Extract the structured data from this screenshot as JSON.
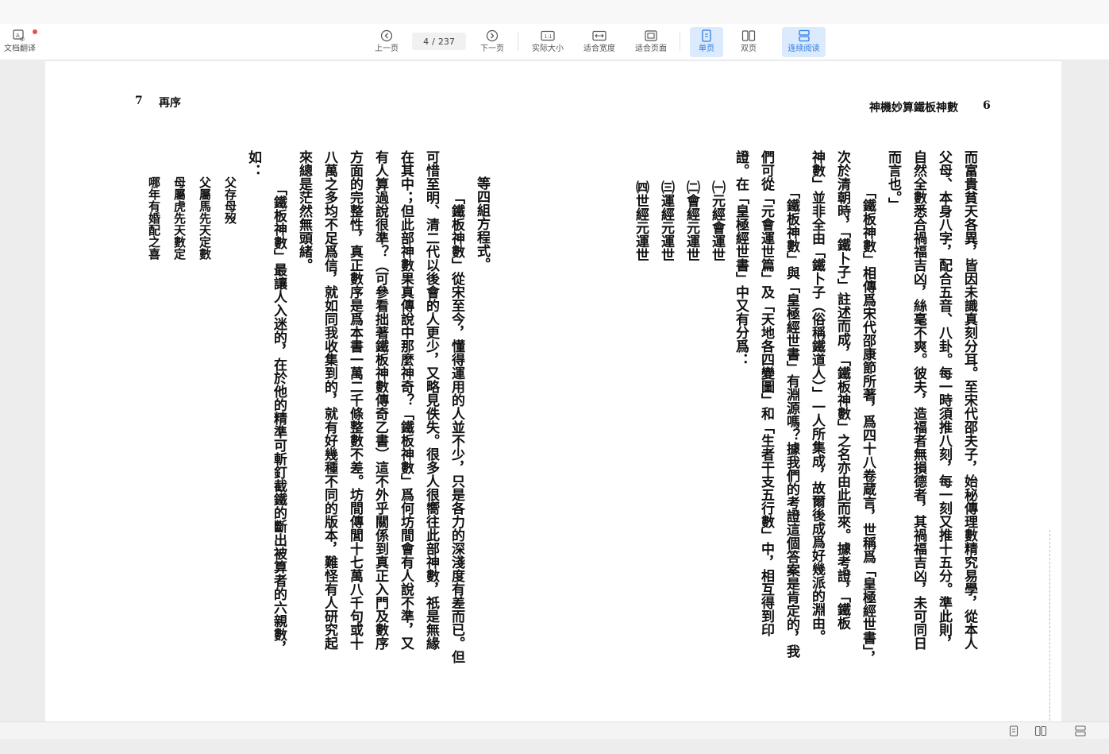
{
  "toolbar": {
    "translate_label": "文档翻译",
    "prev_label": "上一页",
    "next_label": "下一页",
    "page_current": "4",
    "page_sep": "/",
    "page_total": "237",
    "actual_size_label": "实际大小",
    "fit_width_label": "适合宽度",
    "fit_page_label": "适合页面",
    "single_page_label": "单页",
    "double_page_label": "双页",
    "continuous_label": "连续阅读",
    "accent_color": "#2f7de1"
  },
  "document": {
    "left_page_number": "7",
    "left_page_title": "再序",
    "right_page_title": "神機妙算鐵板神數",
    "right_page_number": "6",
    "right_columns": [
      "而富貴貧天各異，皆因未識真刻分耳。至宋代邵夫子，始秘傳理數精究易學，從本人",
      "父母、本身八字，配合五音、八卦。每一時須推八刻，每一刻又推十五分。準此則，",
      "自然全數悉合禍福吉凶，絲毫不爽。彼夫，造福者無損德者，其禍福吉凶，未可同日",
      "而言也。」",
      "「鐵板神數」相傳爲宋代邵康節所著，爲四十八卷蔵言，世稱爲「皇極經世書」，",
      "次於清朝時，「鐵卜子」註述而成，「鐵板神數」之名亦由此而來。據考證，「鐵板",
      "神數」並非全由「鐵卜子（俗稱鐵道人）」一人所集成，故爾後成爲好幾派的淵由。",
      "「鐵板神數」與「皇極經世書」有淵源嗎？據我們的考證這個答案是肯定的，我",
      "們可從「元會運世篇」及「天地各四變圖」和「生者干支五行數」中，相互得到印",
      "證。在「皇極經世書」中又有分爲：",
      "㈠元經會運世",
      "㈡會經元運世",
      "㈢運經元運世",
      "㈣世經元運世"
    ],
    "left_columns": [
      "等四組方程式。",
      "「鐵板神數」從宋至今，懂得運用的人並不少，只是各力的深淺度有差而已。但",
      "可惜至明、清二代以後會的人更少，又略見佚失。很多人很嚮往此部神數，祇是無緣",
      "在其中；但此部神數果真傳說中那麼神奇？「鐵板神數」爲何坊間會有人說不準，又",
      "有人算過說很準？（可參看拙著鐵板神數傳奇乙書）這不外乎關係到真正入門及數序",
      "方面的完整性，真正數序是爲本書一萬二千條整數不差。坊間傳閭十七萬八千句或十",
      "八萬之多均不足爲信，就如同我收集到的，就有好幾種不同的版本，難怪有人研究起",
      "來總是茫然無頭緒。",
      "「鐵板神數」最讓人入迷的，在於他的精準可斬釘截鐵的斷出被算者的六親數，",
      "如：",
      "父存母歿",
      "父屬馬先天定數",
      "母屬虎先天數定",
      "哪年有婚配之喜"
    ]
  }
}
